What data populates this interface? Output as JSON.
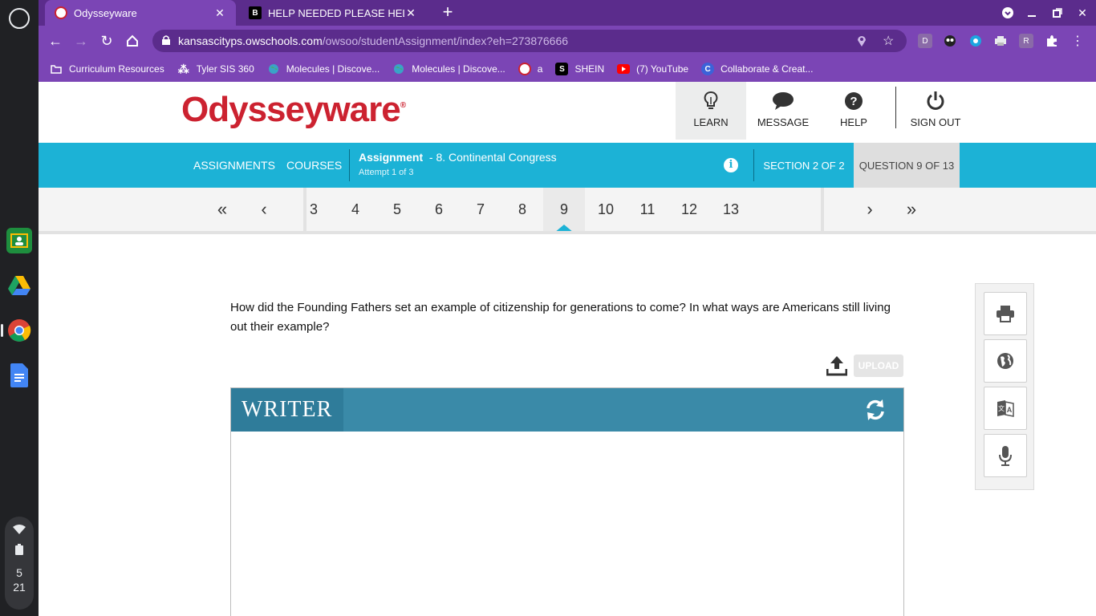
{
  "shelf": {
    "apps": [
      "google-classroom",
      "google-drive",
      "google-chrome",
      "google-docs"
    ],
    "clock_hour": "5",
    "clock_minute": "21"
  },
  "browser": {
    "tabs": [
      {
        "title": "Odysseyware",
        "active": true
      },
      {
        "title": "HELP NEEDED PLEASE HELP NO",
        "active": false
      }
    ],
    "url_domain": "kansascityps.owschools.com",
    "url_path": "/owsoo/studentAssignment/index?eh=273876666",
    "extensions": [
      "D",
      "R"
    ],
    "bookmarks": [
      "Curriculum Resources",
      "Tyler SIS 360",
      "Molecules | Discove...",
      "Molecules | Discove...",
      "a",
      "SHEIN",
      "(7) YouTube",
      "Collaborate & Creat..."
    ]
  },
  "header": {
    "logo": "Odysseyware",
    "logo_mark": "®",
    "nav": [
      {
        "label": "LEARN",
        "icon": "lightbulb-icon",
        "active": true
      },
      {
        "label": "MESSAGE",
        "icon": "chat-bubble-icon",
        "active": false
      },
      {
        "label": "HELP",
        "icon": "question-icon",
        "active": false
      },
      {
        "label": "SIGN OUT",
        "icon": "power-icon",
        "active": false
      }
    ]
  },
  "assignment_bar": {
    "links": [
      "ASSIGNMENTS",
      "COURSES"
    ],
    "assignment_label": "Assignment",
    "assignment_name": "- 8. Continental Congress",
    "attempt": "Attempt 1 of 3",
    "section": "SECTION 2 OF 2",
    "question": "QUESTION 9 OF 13"
  },
  "question_nav": {
    "numbers": [
      "3",
      "4",
      "5",
      "6",
      "7",
      "8",
      "9",
      "10",
      "11",
      "12",
      "13"
    ],
    "current": "9"
  },
  "question": {
    "prompt": "How did the Founding Fathers set an example of citizenship for generations to come? In what ways are Americans still living out their example?",
    "upload_label": "UPLOAD",
    "writer_title": "WRITER"
  },
  "tools": [
    "print-icon",
    "globe-icon",
    "translate-icon",
    "microphone-icon"
  ],
  "colors": {
    "browser_purple": "#7b45b5",
    "brand_red": "#cc2230",
    "accent_blue": "#1cb2d6",
    "writer_teal": "#3a8aa8"
  }
}
